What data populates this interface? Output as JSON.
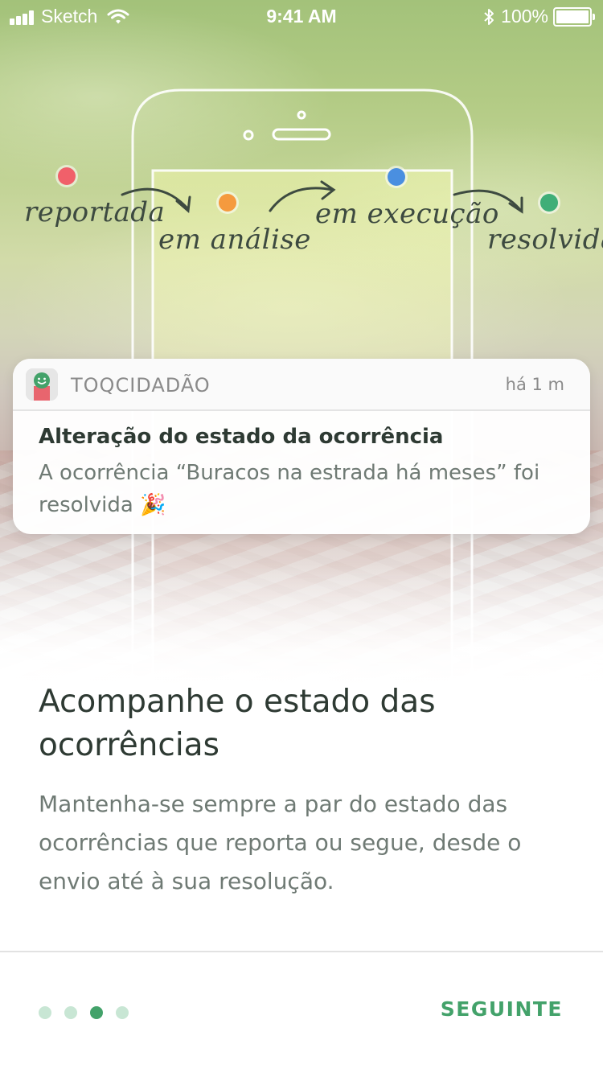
{
  "status_bar": {
    "carrier": "Sketch",
    "time": "9:41 AM",
    "battery": "100%",
    "battery_level": 1.0
  },
  "illustration": {
    "steps": [
      {
        "label": "reportada",
        "color": "#f0606a"
      },
      {
        "label": "em análise",
        "color": "#f59a3e"
      },
      {
        "label": "em execução",
        "color": "#4a8fe0"
      },
      {
        "label": "resolvida",
        "color": "#3fae78"
      }
    ]
  },
  "notification": {
    "app_name": "TOQCIDADÃO",
    "time": "há 1 m",
    "title": "Alteração do estado da ocorrência",
    "body": "A ocorrência “Buracos na estrada há meses” foi resolvida 🎉"
  },
  "content": {
    "headline": "Acompanhe o estado das ocorrências",
    "description": "Mantenha-se sempre a par do estado das ocorrências que reporta ou segue, desde o envio até à sua resolução."
  },
  "footer": {
    "page_count": 4,
    "current_page": 3,
    "next_label": "SEGUINTE"
  },
  "colors": {
    "accent": "#43a26a",
    "pager_inactive": "#c8e6d4",
    "heading": "#2e3a33",
    "body_text": "#6f7a74"
  }
}
